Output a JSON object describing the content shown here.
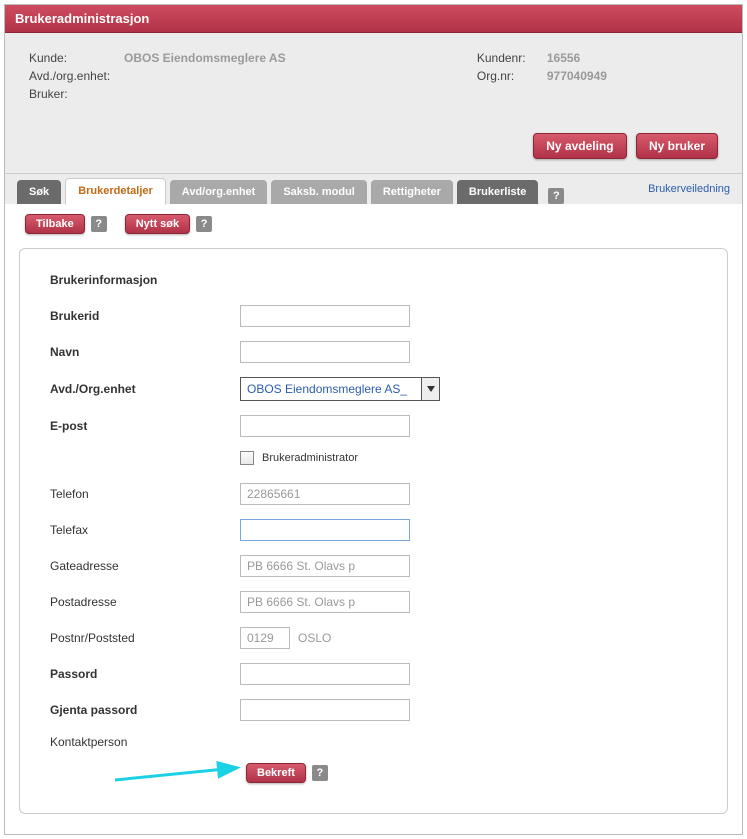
{
  "header": {
    "title": "Brukeradministrasjon"
  },
  "info": {
    "left": {
      "kunde_label": "Kunde:",
      "kunde_value": "OBOS Eiendomsmeglere AS",
      "avd_label": "Avd./org.enhet:",
      "avd_value": "",
      "bruker_label": "Bruker:",
      "bruker_value": ""
    },
    "right": {
      "kundenr_label": "Kundenr:",
      "kundenr_value": "16556",
      "orgnr_label": "Org.nr:",
      "orgnr_value": "977040949"
    }
  },
  "actions": {
    "ny_avdeling": "Ny avdeling",
    "ny_bruker": "Ny bruker"
  },
  "tabs": {
    "sok": "Søk",
    "brukerdetaljer": "Brukerdetaljer",
    "avdorg": "Avd/org.enhet",
    "saksb": "Saksb. modul",
    "rettigheter": "Rettigheter",
    "brukerliste": "Brukerliste"
  },
  "help": {
    "icon_text": "?",
    "link": "Brukerveiledning"
  },
  "sub": {
    "tilbake": "Tilbake",
    "nytt_sok": "Nytt søk"
  },
  "form": {
    "section_title": "Brukerinformasjon",
    "brukerid": {
      "label": "Brukerid",
      "value": ""
    },
    "navn": {
      "label": "Navn",
      "value": ""
    },
    "avdorg": {
      "label": "Avd./Org.enhet",
      "selected": "OBOS Eiendomsmeglere AS_"
    },
    "epost": {
      "label": "E-post",
      "value": ""
    },
    "brukeradmin": {
      "label": "Brukeradministrator",
      "checked": false
    },
    "telefon": {
      "label": "Telefon",
      "value": "22865661"
    },
    "telefax": {
      "label": "Telefax",
      "value": ""
    },
    "gateadresse": {
      "label": "Gateadresse",
      "value": "PB 6666 St. Olavs p"
    },
    "postadresse": {
      "label": "Postadresse",
      "value": "PB 6666 St. Olavs p"
    },
    "postnr": {
      "label": "Postnr/Poststed",
      "nr": "0129",
      "sted": "OSLO"
    },
    "passord": {
      "label": "Passord",
      "value": ""
    },
    "gjenta": {
      "label": "Gjenta passord",
      "value": ""
    },
    "kontakt": {
      "label": "Kontaktperson"
    },
    "bekreft": "Bekreft"
  },
  "annotation": {
    "arrow_color": "#1ad1e6"
  }
}
